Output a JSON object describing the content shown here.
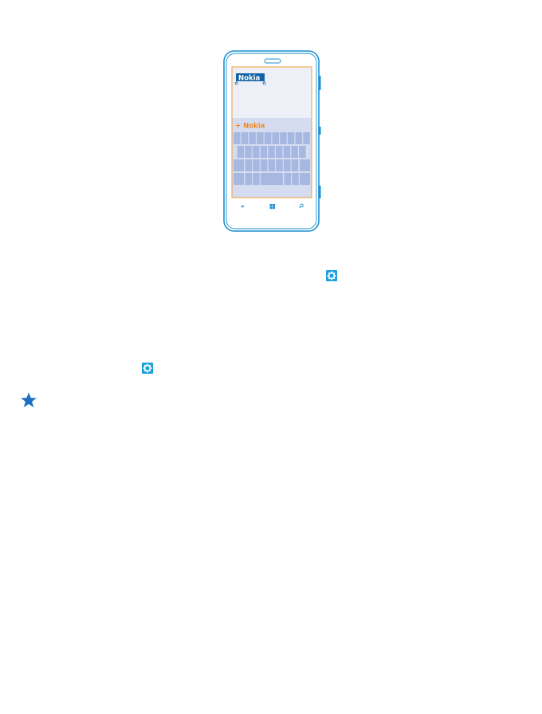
{
  "phone": {
    "selected_word": "Nokia",
    "suggestion": "+ Nokia",
    "nav_keys": [
      "back-key",
      "start-key",
      "search-key"
    ]
  },
  "icons": {
    "settings_1": "gear-icon",
    "settings_2": "gear-icon",
    "tip": "star-icon"
  },
  "colors": {
    "phone_outline": "#1a8fd0",
    "screen_border": "#f39c33",
    "accent_orange": "#f08a24",
    "screen_bg": "#eef0f8",
    "keyboard_bg": "#d5dcef",
    "key_fill": "#a6b8e2",
    "selection_bg": "#1464a5",
    "settings_icon_bg": "#1aa0dc",
    "star": "#1a6fc0"
  }
}
